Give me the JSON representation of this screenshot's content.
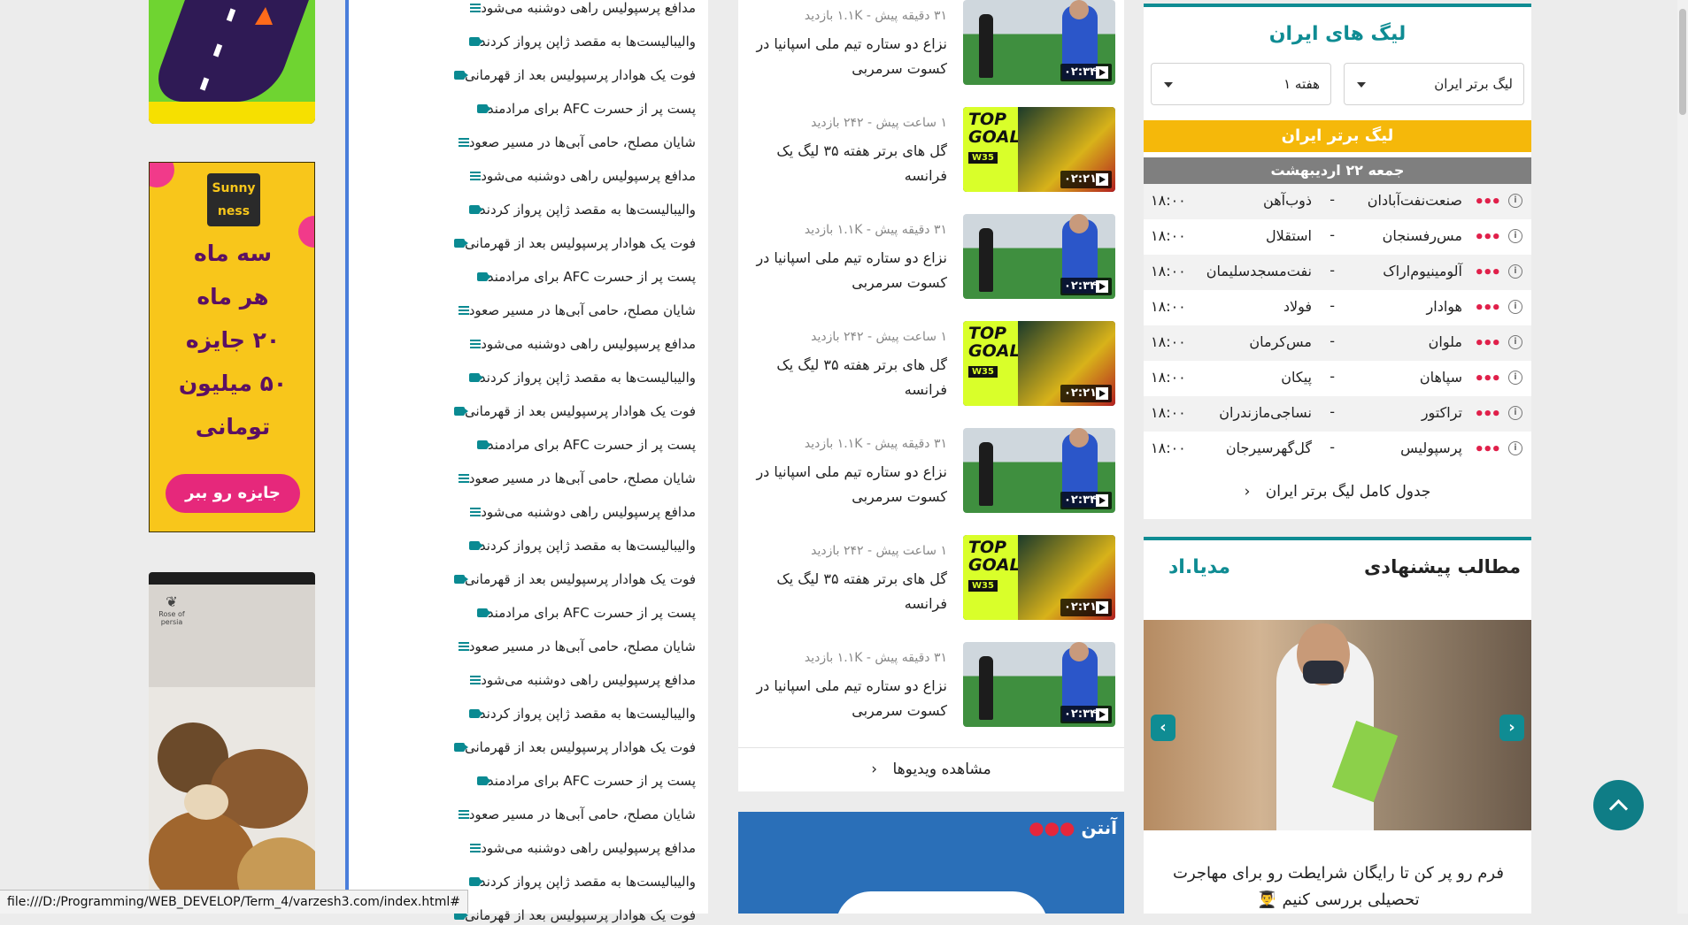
{
  "ads": {
    "sunny_logo": "Sunny ness",
    "sunny_lines": [
      "سه ماه",
      "هر ماه",
      "۲۰ جایزه",
      "۵۰ میلیون",
      "تومانی"
    ],
    "sunny_cta": "جایزه رو ببر",
    "persia_brand": "Rose of persia"
  },
  "articles": [
    {
      "icon": "text",
      "title": "مدافع پرسپولیس راهی دوشنبه می‌شود"
    },
    {
      "icon": "video",
      "title": "والیبالیست‌ها به مقصد ژاپن پرواز کردند"
    },
    {
      "icon": "video",
      "title": "فوت یک هوادار پرسپولیس بعد از قهرمانی"
    },
    {
      "icon": "video",
      "title": "پست پر از حسرت AFC برای مرادمند"
    },
    {
      "icon": "text",
      "title": "شایان مصلح، حامی آبی‌ها در مسیر صعود"
    },
    {
      "icon": "text",
      "title": "مدافع پرسپولیس راهی دوشنبه می‌شود"
    },
    {
      "icon": "video",
      "title": "والیبالیست‌ها به مقصد ژاپن پرواز کردند"
    },
    {
      "icon": "video",
      "title": "فوت یک هوادار پرسپولیس بعد از قهرمانی"
    },
    {
      "icon": "video",
      "title": "پست پر از حسرت AFC برای مرادمند"
    },
    {
      "icon": "text",
      "title": "شایان مصلح، حامی آبی‌ها در مسیر صعود"
    },
    {
      "icon": "text",
      "title": "مدافع پرسپولیس راهی دوشنبه می‌شود"
    },
    {
      "icon": "video",
      "title": "والیبالیست‌ها به مقصد ژاپن پرواز کردند"
    },
    {
      "icon": "video",
      "title": "فوت یک هوادار پرسپولیس بعد از قهرمانی"
    },
    {
      "icon": "video",
      "title": "پست پر از حسرت AFC برای مرادمند"
    },
    {
      "icon": "text",
      "title": "شایان مصلح، حامی آبی‌ها در مسیر صعود"
    },
    {
      "icon": "text",
      "title": "مدافع پرسپولیس راهی دوشنبه می‌شود"
    },
    {
      "icon": "video",
      "title": "والیبالیست‌ها به مقصد ژاپن پرواز کردند"
    },
    {
      "icon": "video",
      "title": "فوت یک هوادار پرسپولیس بعد از قهرمانی"
    },
    {
      "icon": "video",
      "title": "پست پر از حسرت AFC برای مرادمند"
    },
    {
      "icon": "text",
      "title": "شایان مصلح، حامی آبی‌ها در مسیر صعود"
    },
    {
      "icon": "text",
      "title": "مدافع پرسپولیس راهی دوشنبه می‌شود"
    },
    {
      "icon": "video",
      "title": "والیبالیست‌ها به مقصد ژاپن پرواز کردند"
    },
    {
      "icon": "video",
      "title": "فوت یک هوادار پرسپولیس بعد از قهرمانی"
    },
    {
      "icon": "video",
      "title": "پست پر از حسرت AFC برای مرادمند"
    },
    {
      "icon": "text",
      "title": "شایان مصلح، حامی آبی‌ها در مسیر صعود"
    },
    {
      "icon": "text",
      "title": "مدافع پرسپولیس راهی دوشنبه می‌شود"
    },
    {
      "icon": "video",
      "title": "والیبالیست‌ها به مقصد ژاپن پرواز کردند"
    },
    {
      "icon": "video",
      "title": "فوت یک هوادار پرسپولیس بعد از قهرمانی"
    }
  ],
  "videos": [
    {
      "kind": "a",
      "meta": "۳۱ دقیقه پیش - ۱.۱K بازدید",
      "title": "نزاع دو ستاره تیم ملی اسپانیا در کسوت سرمربی",
      "duration": "۰۲:۳۴"
    },
    {
      "kind": "b",
      "meta": "۱ ساعت پیش - ۲۴۲ بازدید",
      "title": "گل های برتر هفته ۳۵ لیگ یک فرانسه",
      "duration": "۰۲:۲۱"
    },
    {
      "kind": "a",
      "meta": "۳۱ دقیقه پیش - ۱.۱K بازدید",
      "title": "نزاع دو ستاره تیم ملی اسپانیا در کسوت سرمربی",
      "duration": "۰۲:۳۴"
    },
    {
      "kind": "b",
      "meta": "۱ ساعت پیش - ۲۴۲ بازدید",
      "title": "گل های برتر هفته ۳۵ لیگ یک فرانسه",
      "duration": "۰۲:۲۱"
    },
    {
      "kind": "a",
      "meta": "۳۱ دقیقه پیش - ۱.۱K بازدید",
      "title": "نزاع دو ستاره تیم ملی اسپانیا در کسوت سرمربی",
      "duration": "۰۲:۳۴"
    },
    {
      "kind": "b",
      "meta": "۱ ساعت پیش - ۲۴۲ بازدید",
      "title": "گل های برتر هفته ۳۵ لیگ یک فرانسه",
      "duration": "۰۲:۲۱"
    },
    {
      "kind": "a",
      "meta": "۳۱ دقیقه پیش - ۱.۱K بازدید",
      "title": "نزاع دو ستاره تیم ملی اسپانیا در کسوت سرمربی",
      "duration": "۰۲:۳۴"
    }
  ],
  "video_thumb_text": {
    "top": "TOP",
    "goals": "GOALS",
    "w35": "W35"
  },
  "videos_more": "مشاهده ویدیوها",
  "promo_brand": "آنتن",
  "league": {
    "heading": "لیگ های ایران",
    "league_select": "لیگ برتر ایران",
    "week_select": "هفته ۱",
    "band": "لیگ برتر ایران",
    "date": "جمعه ۲۲ اردیبهشت",
    "matches": [
      {
        "home": "صنعت‌نفت‌آبادان",
        "away": "ذوب‌آهن",
        "time": "۱۸:۰۰"
      },
      {
        "home": "مس‌رفسنجان",
        "away": "استقلال",
        "time": "۱۸:۰۰"
      },
      {
        "home": "آلومینیوم‌اراک",
        "away": "نفت‌مسجدسلیمان",
        "time": "۱۸:۰۰"
      },
      {
        "home": "هوادار",
        "away": "فولاد",
        "time": "۱۸:۰۰"
      },
      {
        "home": "ملوان",
        "away": "مس‌کرمان",
        "time": "۱۸:۰۰"
      },
      {
        "home": "سپاهان",
        "away": "پیکان",
        "time": "۱۸:۰۰"
      },
      {
        "home": "تراکتور",
        "away": "نساجی‌مازندران",
        "time": "۱۸:۰۰"
      },
      {
        "home": "پرسپولیس",
        "away": "گل‌گهرسیرجان",
        "time": "۱۸:۰۰"
      }
    ],
    "full_table": "جدول کامل لیگ برتر ایران"
  },
  "recommended": {
    "heading": "مطالب پیشنهادی",
    "brand": "مدیا.اد",
    "caption": "فرم رو پر کن تا رایگان شرایطت رو برای مهاجرت تحصیلی بررسی کنیم 👨‍🎓"
  },
  "status_url": "file:///D:/Programming/WEB_DEVELOP/Term_4/varzesh3.com/index.html#",
  "colors": {
    "accent": "#0f8c93",
    "band": "#f5b80a",
    "date_band": "#7f7f7f",
    "list_border": "#4a7edb",
    "dots": "#e0204a"
  }
}
